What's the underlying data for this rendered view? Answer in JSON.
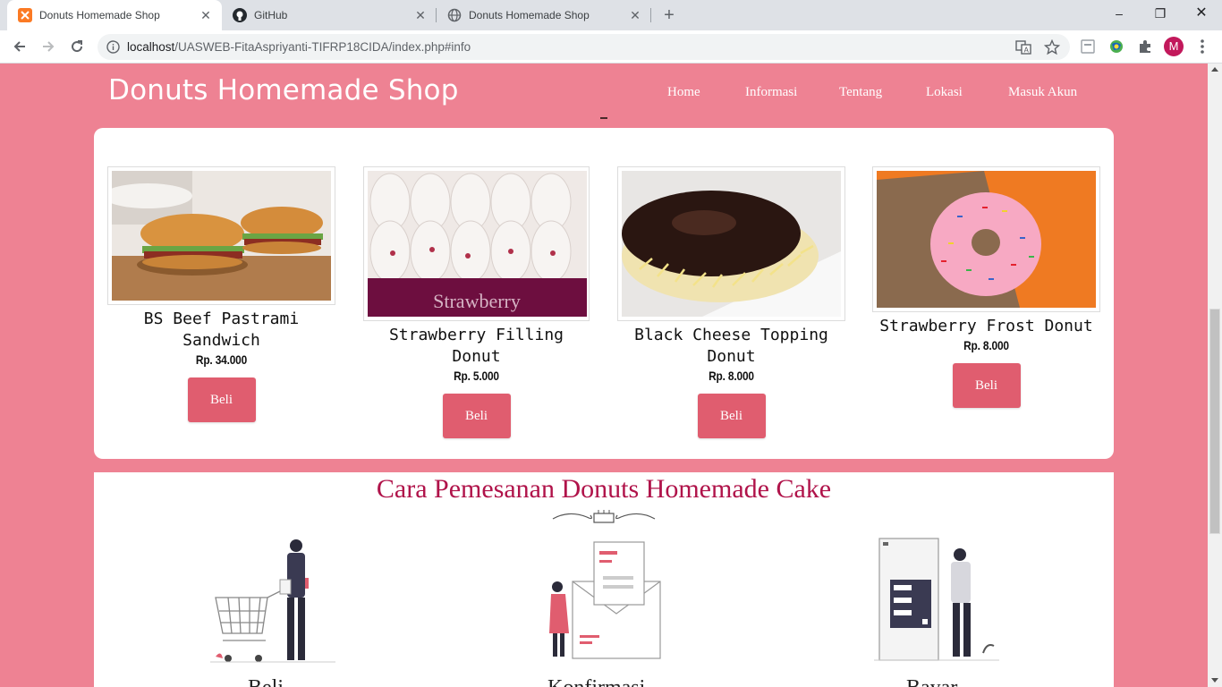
{
  "browser": {
    "tabs": [
      {
        "title": "Donuts Homemade Shop",
        "favicon": "xampp-icon",
        "active": true
      },
      {
        "title": "GitHub",
        "favicon": "github-icon",
        "active": false
      },
      {
        "title": "Donuts Homemade Shop",
        "favicon": "globe-icon",
        "active": false
      }
    ],
    "url_host": "localhost",
    "url_path": "/UASWEB-FitaAspriyanti-TIFRP18CIDA/index.php#info",
    "profile_initial": "M",
    "accent": "#c2185b"
  },
  "site": {
    "brand": "Donuts Homemade Shop",
    "nav": [
      "Home",
      "Informasi",
      "Tentang",
      "Lokasi",
      "Masuk Akun"
    ],
    "colors": {
      "background": "#ee8293",
      "button": "#e05d6f",
      "heading": "#b0134a"
    }
  },
  "products": [
    {
      "name": "BS Beef Pastrami Sandwich",
      "price": "Rp. 34.000",
      "button": "Beli",
      "image": "sandwich-photo"
    },
    {
      "name": "Strawberry Filling Donut",
      "price": "Rp. 5.000",
      "button": "Beli",
      "image": "strawberry-donut-photo",
      "image_caption": "Strawberry"
    },
    {
      "name": "Black Cheese Topping Donut",
      "price": "Rp. 8.000",
      "button": "Beli",
      "image": "cheese-donut-photo"
    },
    {
      "name": "Strawberry Frost Donut",
      "price": "Rp. 8.000",
      "button": "Beli",
      "image": "frost-donut-photo"
    }
  ],
  "howto": {
    "title": "Cara Pemesanan Donuts Homemade Cake",
    "steps": [
      {
        "label": "Beli",
        "illustration": "shopping-cart-illustration"
      },
      {
        "label": "Konfirmasi",
        "illustration": "email-confirmation-illustration"
      },
      {
        "label": "Bayar",
        "illustration": "payment-illustration"
      }
    ]
  }
}
